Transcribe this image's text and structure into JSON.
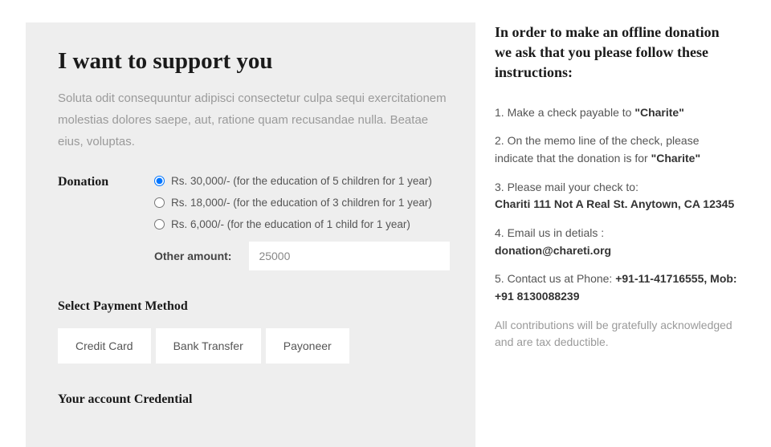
{
  "form": {
    "title": "I want to support you",
    "intro": "Soluta odit consequuntur adipisci consectetur culpa sequi exercitationem molestias dolores saepe, aut, ratione quam recusandae nulla. Beatae eius, voluptas.",
    "donation_label": "Donation",
    "options": [
      "Rs. 30,000/- (for the education of 5 children for 1 year)",
      "Rs. 18,000/- (for the education of 3 children for 1 year)",
      "Rs. 6,000/- (for the education of 1 child for 1 year)"
    ],
    "selected_index": 0,
    "other_label": "Other amount:",
    "other_value": "25000",
    "payment_title": "Select Payment Method",
    "payment_methods": [
      "Credit Card",
      "Bank Transfer",
      "Payoneer"
    ],
    "credential_title": "Your account Credential"
  },
  "offline": {
    "title": "In order to make an offline donation we ask that you please follow these instructions:",
    "step1_pre": "1. Make a check payable to ",
    "step1_bold": "\"Charite\"",
    "step2_pre": "2. On the memo line of the check, please indicate that the donation is for ",
    "step2_bold": "\"Charite\"",
    "step3_pre": "3. Please mail your check to:",
    "step3_addr": "Chariti 111 Not A Real St. Anytown, CA 12345",
    "step4_pre": "4. Email us in detials :",
    "step4_email": "donation@chareti.org",
    "step5_pre": "5. Contact us at Phone: ",
    "step5_phone": "+91-11-41716555, Mob: +91 8130088239",
    "footer": "All contributions will be gratefully acknowledged and are tax deductible."
  }
}
